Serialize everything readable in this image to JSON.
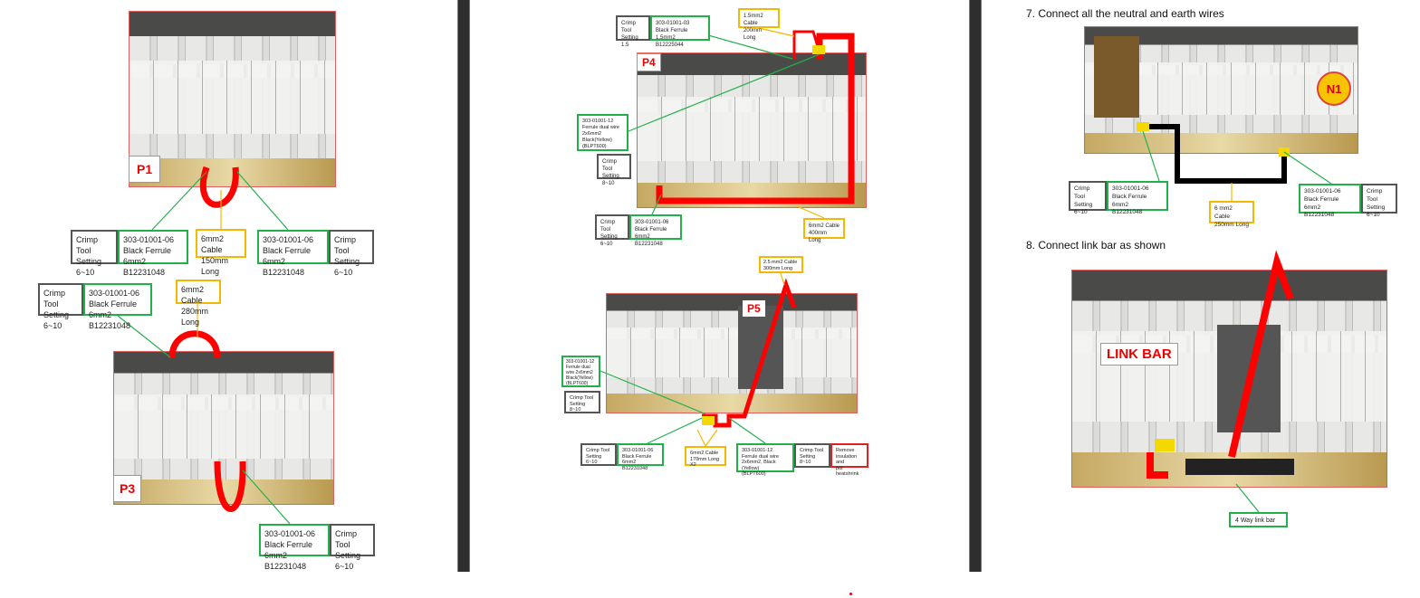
{
  "pages": [
    {
      "photos": {
        "p1": "P1",
        "p3": "P3"
      },
      "labels": {
        "crimp_a": "Crimp Tool\nSetting\n6~10",
        "ferrule_a": "303-01001-06\nBlack Ferrule 6mm2\nB12231048",
        "cable_a": "6mm2 Cable\n150mm Long",
        "ferrule_b": "303-01001-06\nBlack Ferrule 6mm2\nB12231048",
        "crimp_b": "Crimp Tool\nSetting\n6~10",
        "crimp_c": "Crimp Tool\nSetting\n6~10",
        "ferrule_c": "303-01001-06\nBlack Ferrule 6mm2\nB12231048",
        "cable_c": "6mm2 Cable\n280mm Long",
        "ferrule_d": "303-01001-06\nBlack Ferrule 6mm2\nB12231048",
        "crimp_d": "Crimp Tool\nSetting\n6~10"
      }
    },
    {
      "photos": {
        "p4": "P4",
        "p5": "P5"
      },
      "labels": {
        "crimp_1": "Crimp Tool\nSetting\n1.5",
        "ferrule_1": "303-01001-03\nBlack Ferrule 1.5mm2\nB12225044",
        "cable_1": "1.5mm2 Cable\n200mm Long",
        "ferrule_2": "303-01001-12\nFerrule dual wire\n2x6mm2\nBlack(Yellow)\n(BLPT600)",
        "crimp_2": "Crimp Tool\nSetting\n8~10",
        "crimp_3": "Crimp Tool\nSetting\n6~10",
        "ferrule_3": "303-01001-06\nBlack Ferrule 6mm2\nB12231048",
        "cable_3": "6mm2 Cable\n400mm Long",
        "cable_4": "2.5 mm2 Cable\n300mm Long",
        "ferrule_4": "303-01001-12\nFerrule dual\nwire 2x6mm2\nBlack(Yellow)\n(BLPT600)",
        "crimp_4": "Crimp Tool\nSetting\n8~10",
        "crimp_5": "Crimp Tool\nSetting\n6~10",
        "ferrule_5": "303-01001-06\nBlack Ferrule 6mm2\nB12231048",
        "cable_5": "6mm2 Cable\n170mm Long X2",
        "ferrule_6": "303-01001-12\nFerrule dual wire\n2x6mm2, Black (Yellow)\n(BLPT600)",
        "crimp_6": "Crimp Tool\nSetting\n8~10",
        "note_6": "Remove\ninsulation and\nput heatshrink"
      }
    },
    {
      "step7": "7.  Connect all the neutral and earth wires",
      "step8": "8.  Connect link bar as shown",
      "n1": "N1",
      "link_bar_label": "LINK BAR",
      "labels": {
        "crimp_a": "Crimp Tool\nSetting\n6~10",
        "ferrule_a": "303-01001-06\nBlack Ferrule 6mm2\nB12231048",
        "cable_a": "6 mm2 Cable\n250mm Long",
        "ferrule_b": "303-01001-06\nBlack Ferrule 6mm2\nB12231048",
        "crimp_b": "Crimp Tool\nSetting\n6~10",
        "link_bar": "4 Way link bar"
      }
    }
  ],
  "colors": {
    "wire": "#ff0000",
    "ferrule_box": "#22b04b",
    "cable_box": "#f5b800",
    "crimp_box": "#555555",
    "background": "#2e2e2e"
  }
}
